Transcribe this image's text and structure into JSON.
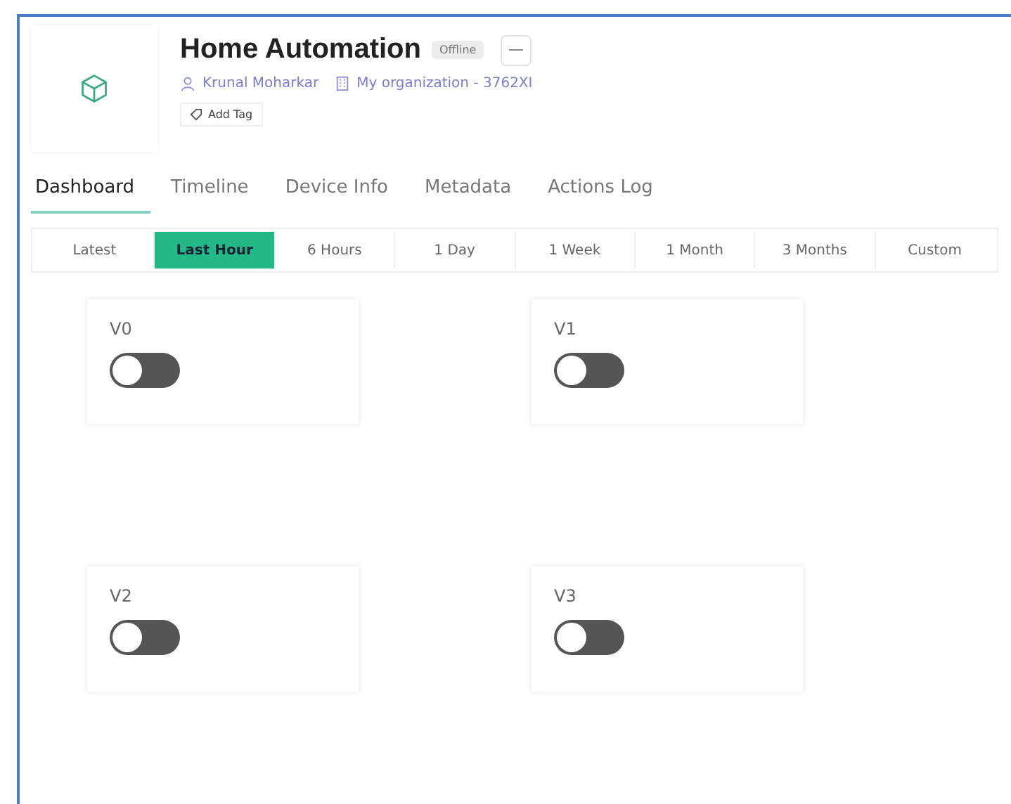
{
  "device": {
    "title": "Home Automation",
    "status": "Offline",
    "owner": "Krunal Moharkar",
    "organization": "My organization - 3762XI",
    "add_tag": "Add Tag"
  },
  "tabs": [
    {
      "label": "Dashboard",
      "selected": true
    },
    {
      "label": "Timeline",
      "selected": false
    },
    {
      "label": "Device Info",
      "selected": false
    },
    {
      "label": "Metadata",
      "selected": false
    },
    {
      "label": "Actions Log",
      "selected": false
    }
  ],
  "ranges": [
    {
      "label": "Latest",
      "selected": false
    },
    {
      "label": "Last Hour",
      "selected": true
    },
    {
      "label": "6 Hours",
      "selected": false
    },
    {
      "label": "1 Day",
      "selected": false
    },
    {
      "label": "1 Week",
      "selected": false
    },
    {
      "label": "1 Month",
      "selected": false
    },
    {
      "label": "3 Months",
      "selected": false
    },
    {
      "label": "Custom",
      "selected": false
    }
  ],
  "widgets": [
    {
      "label": "V0",
      "on": false
    },
    {
      "label": "V1",
      "on": false
    },
    {
      "label": "V2",
      "on": false
    },
    {
      "label": "V3",
      "on": false
    }
  ]
}
